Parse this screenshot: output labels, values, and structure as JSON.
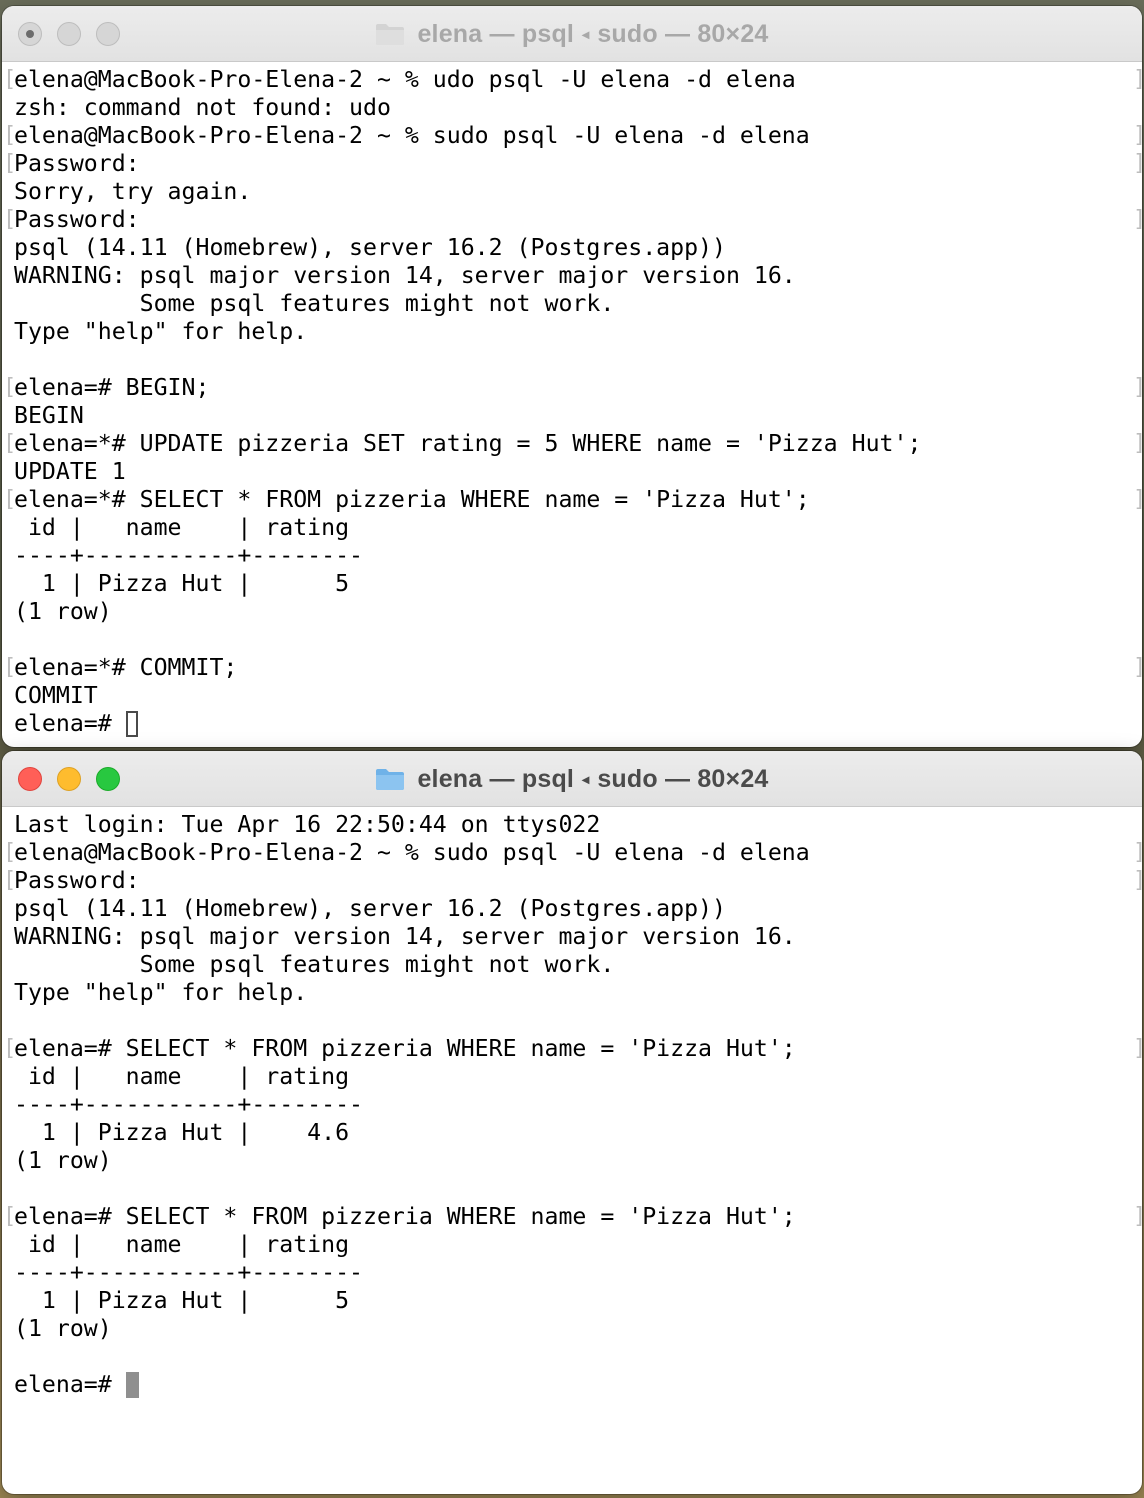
{
  "windows": [
    {
      "title": "elena — psql",
      "title_suffix": "sudo — 80×24",
      "active": false,
      "lines": [
        {
          "text": "elena@MacBook-Pro-Elena-2 ~ % udo psql -U elena -d elena",
          "marked": true
        },
        {
          "text": "zsh: command not found: udo",
          "marked": false
        },
        {
          "text": "elena@MacBook-Pro-Elena-2 ~ % sudo psql -U elena -d elena",
          "marked": true
        },
        {
          "text": "Password:",
          "marked": true
        },
        {
          "text": "Sorry, try again.",
          "marked": false
        },
        {
          "text": "Password:",
          "marked": true
        },
        {
          "text": "psql (14.11 (Homebrew), server 16.2 (Postgres.app))",
          "marked": false
        },
        {
          "text": "WARNING: psql major version 14, server major version 16.",
          "marked": false
        },
        {
          "text": "         Some psql features might not work.",
          "marked": false
        },
        {
          "text": "Type \"help\" for help.",
          "marked": false
        },
        {
          "text": "",
          "marked": false
        },
        {
          "text": "elena=# BEGIN;",
          "marked": true
        },
        {
          "text": "BEGIN",
          "marked": false
        },
        {
          "text": "elena=*# UPDATE pizzeria SET rating = 5 WHERE name = 'Pizza Hut';",
          "marked": true
        },
        {
          "text": "UPDATE 1",
          "marked": false
        },
        {
          "text": "elena=*# SELECT * FROM pizzeria WHERE name = 'Pizza Hut';",
          "marked": true
        },
        {
          "text": " id |   name    | rating",
          "marked": false
        },
        {
          "text": "----+-----------+--------",
          "marked": false
        },
        {
          "text": "  1 | Pizza Hut |      5",
          "marked": false
        },
        {
          "text": "(1 row)",
          "marked": false
        },
        {
          "text": "",
          "marked": false
        },
        {
          "text": "elena=*# COMMIT;",
          "marked": true
        },
        {
          "text": "COMMIT",
          "marked": false
        },
        {
          "text": "elena=# ",
          "marked": false,
          "cursor": "hollow"
        }
      ]
    },
    {
      "title": "elena — psql",
      "title_suffix": "sudo — 80×24",
      "active": true,
      "lines": [
        {
          "text": "Last login: Tue Apr 16 22:50:44 on ttys022",
          "marked": false
        },
        {
          "text": "elena@MacBook-Pro-Elena-2 ~ % sudo psql -U elena -d elena",
          "marked": true
        },
        {
          "text": "Password:",
          "marked": true
        },
        {
          "text": "psql (14.11 (Homebrew), server 16.2 (Postgres.app))",
          "marked": false
        },
        {
          "text": "WARNING: psql major version 14, server major version 16.",
          "marked": false
        },
        {
          "text": "         Some psql features might not work.",
          "marked": false
        },
        {
          "text": "Type \"help\" for help.",
          "marked": false
        },
        {
          "text": "",
          "marked": false
        },
        {
          "text": "elena=# SELECT * FROM pizzeria WHERE name = 'Pizza Hut';",
          "marked": true
        },
        {
          "text": " id |   name    | rating",
          "marked": false
        },
        {
          "text": "----+-----------+--------",
          "marked": false
        },
        {
          "text": "  1 | Pizza Hut |    4.6",
          "marked": false
        },
        {
          "text": "(1 row)",
          "marked": false
        },
        {
          "text": "",
          "marked": false
        },
        {
          "text": "elena=# SELECT * FROM pizzeria WHERE name = 'Pizza Hut';",
          "marked": true
        },
        {
          "text": " id |   name    | rating",
          "marked": false
        },
        {
          "text": "----+-----------+--------",
          "marked": false
        },
        {
          "text": "  1 | Pizza Hut |      5",
          "marked": false
        },
        {
          "text": "(1 row)",
          "marked": false
        },
        {
          "text": "",
          "marked": false
        },
        {
          "text": "elena=# ",
          "marked": false,
          "cursor": "solid"
        }
      ]
    }
  ],
  "colors": {
    "close": "#ff5f57",
    "minimize": "#febc2e",
    "zoom": "#28c840",
    "folder": "#8cc4f0"
  }
}
